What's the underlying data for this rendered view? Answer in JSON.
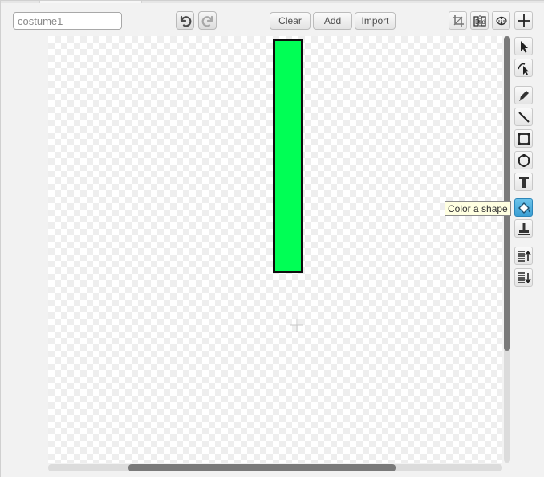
{
  "costume": {
    "name_value": "costume1"
  },
  "toolbar": {
    "undo_icon": "undo-icon",
    "redo_icon": "redo-icon",
    "clear_label": "Clear",
    "add_label": "Add",
    "import_label": "Import",
    "crop_icon": "crop-icon",
    "flip_horizontal_icon": "flip-horizontal-icon",
    "flip_vertical_icon": "flip-vertical-icon",
    "set_center_icon": "set-costume-center-icon"
  },
  "canvas": {
    "background": "checkerboard",
    "shape": {
      "type": "rectangle",
      "fill": "#00ff55",
      "stroke": "#0d0d0d"
    }
  },
  "tools": [
    {
      "id": "select",
      "icon": "arrow-select-icon",
      "active": false
    },
    {
      "id": "reshape",
      "icon": "reshape-icon",
      "active": false
    },
    {
      "id": "pencil",
      "icon": "pencil-icon",
      "active": false
    },
    {
      "id": "line",
      "icon": "line-icon",
      "active": false
    },
    {
      "id": "rectangle",
      "icon": "rectangle-icon",
      "active": false
    },
    {
      "id": "ellipse",
      "icon": "ellipse-icon",
      "active": false
    },
    {
      "id": "text",
      "icon": "text-icon",
      "active": false
    },
    {
      "id": "fill",
      "icon": "paint-bucket-icon",
      "active": true
    },
    {
      "id": "duplicate",
      "icon": "stamp-icon",
      "active": false
    },
    {
      "id": "forward",
      "icon": "bring-forward-icon",
      "active": false
    },
    {
      "id": "backward",
      "icon": "send-backward-icon",
      "active": false
    }
  ],
  "tooltip": {
    "text": "Color a shape"
  },
  "colors": {
    "accent": "#3a9fd4",
    "shape_fill": "#00ff55"
  }
}
